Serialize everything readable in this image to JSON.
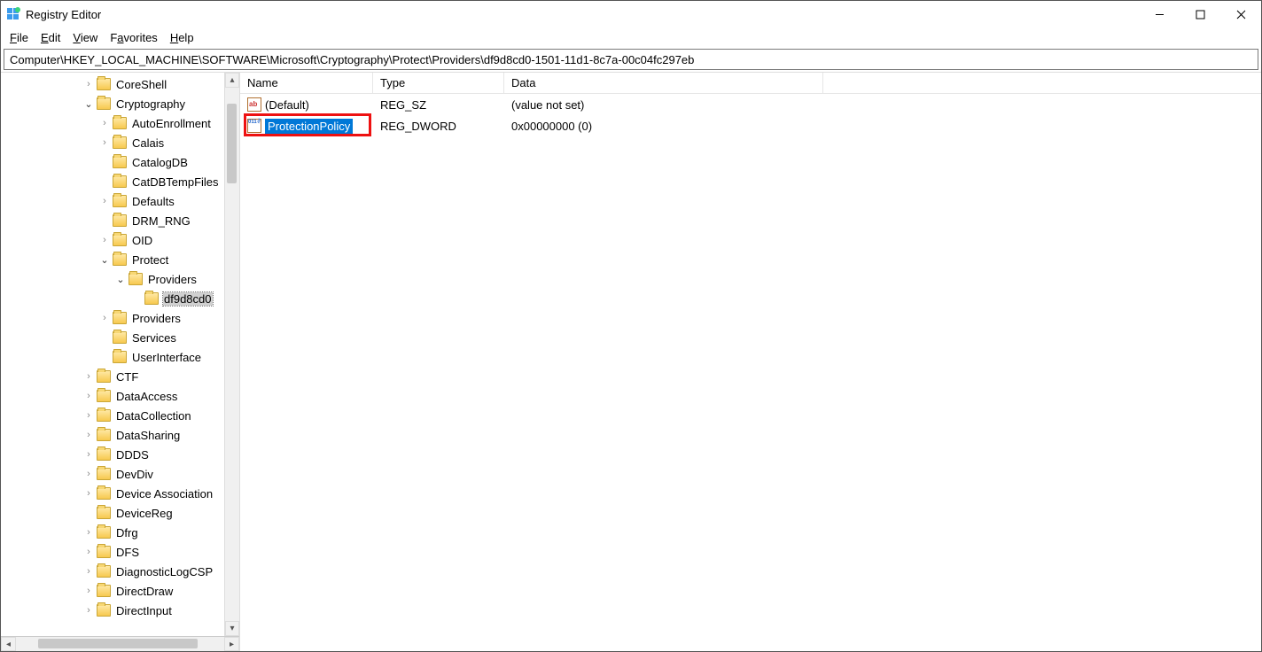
{
  "window": {
    "title": "Registry Editor"
  },
  "menu": {
    "file": "File",
    "edit": "Edit",
    "view": "View",
    "favorites": "Favorites",
    "help": "Help"
  },
  "address": "Computer\\HKEY_LOCAL_MACHINE\\SOFTWARE\\Microsoft\\Cryptography\\Protect\\Providers\\df9d8cd0-1501-11d1-8c7a-00c04fc297eb",
  "tree": [
    {
      "indent": 5,
      "exp": ">",
      "label": "CoreShell"
    },
    {
      "indent": 5,
      "exp": "v",
      "label": "Cryptography"
    },
    {
      "indent": 6,
      "exp": ">",
      "label": "AutoEnrollment"
    },
    {
      "indent": 6,
      "exp": ">",
      "label": "Calais"
    },
    {
      "indent": 6,
      "exp": "",
      "label": "CatalogDB"
    },
    {
      "indent": 6,
      "exp": "",
      "label": "CatDBTempFiles"
    },
    {
      "indent": 6,
      "exp": ">",
      "label": "Defaults"
    },
    {
      "indent": 6,
      "exp": "",
      "label": "DRM_RNG"
    },
    {
      "indent": 6,
      "exp": ">",
      "label": "OID"
    },
    {
      "indent": 6,
      "exp": "v",
      "label": "Protect"
    },
    {
      "indent": 7,
      "exp": "v",
      "label": "Providers"
    },
    {
      "indent": 8,
      "exp": "",
      "label": "df9d8cd0",
      "selected": true
    },
    {
      "indent": 6,
      "exp": ">",
      "label": "Providers"
    },
    {
      "indent": 6,
      "exp": "",
      "label": "Services"
    },
    {
      "indent": 6,
      "exp": "",
      "label": "UserInterface"
    },
    {
      "indent": 5,
      "exp": ">",
      "label": "CTF"
    },
    {
      "indent": 5,
      "exp": ">",
      "label": "DataAccess"
    },
    {
      "indent": 5,
      "exp": ">",
      "label": "DataCollection"
    },
    {
      "indent": 5,
      "exp": ">",
      "label": "DataSharing"
    },
    {
      "indent": 5,
      "exp": ">",
      "label": "DDDS"
    },
    {
      "indent": 5,
      "exp": ">",
      "label": "DevDiv"
    },
    {
      "indent": 5,
      "exp": ">",
      "label": "Device Association"
    },
    {
      "indent": 5,
      "exp": "",
      "label": "DeviceReg"
    },
    {
      "indent": 5,
      "exp": ">",
      "label": "Dfrg"
    },
    {
      "indent": 5,
      "exp": ">",
      "label": "DFS"
    },
    {
      "indent": 5,
      "exp": ">",
      "label": "DiagnosticLogCSP"
    },
    {
      "indent": 5,
      "exp": ">",
      "label": "DirectDraw"
    },
    {
      "indent": 5,
      "exp": ">",
      "label": "DirectInput"
    }
  ],
  "columns": {
    "name": "Name",
    "type": "Type",
    "data": "Data"
  },
  "values": [
    {
      "icon": "str",
      "name": "(Default)",
      "type": "REG_SZ",
      "data": "(value not set)",
      "selected": false
    },
    {
      "icon": "bin",
      "name": "ProtectionPolicy",
      "type": "REG_DWORD",
      "data": "0x00000000 (0)",
      "selected": true,
      "highlight": true
    }
  ]
}
